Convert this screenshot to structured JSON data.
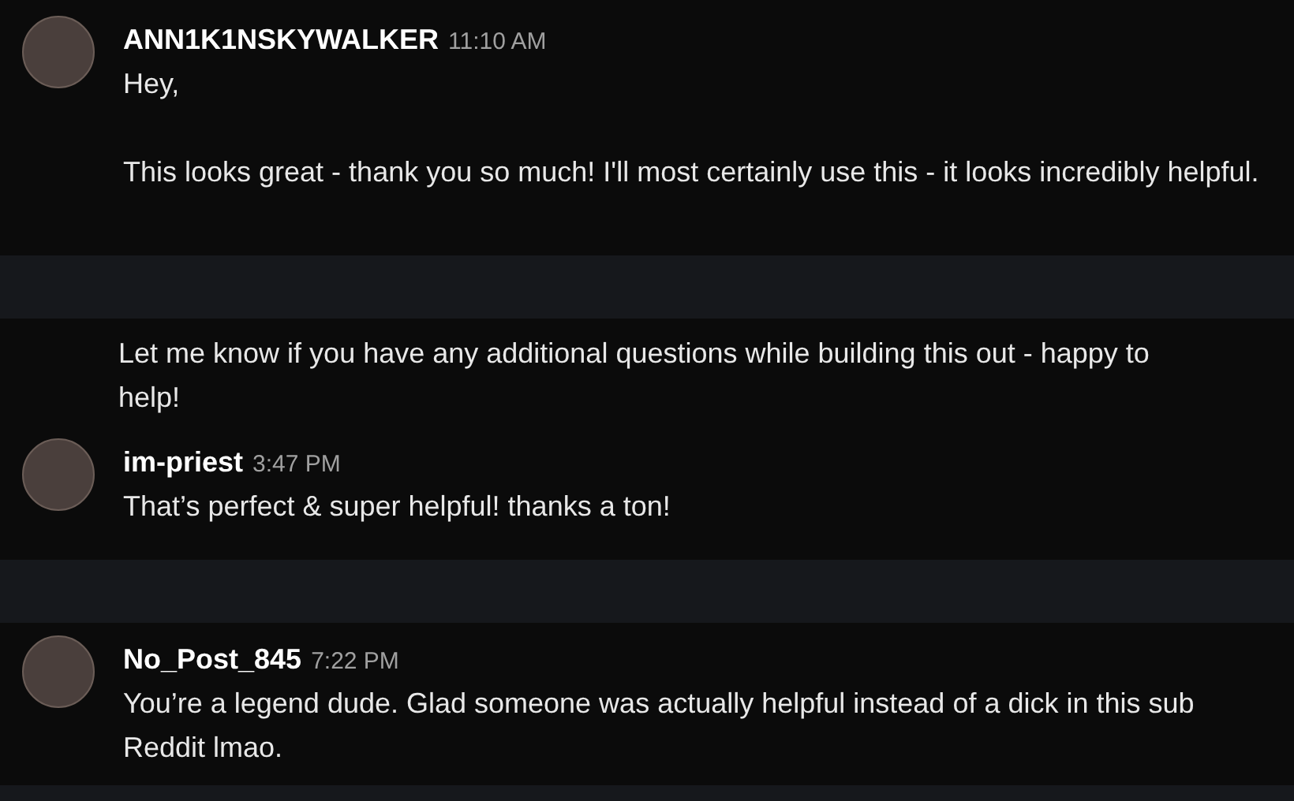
{
  "panels": [
    {
      "messages": [
        {
          "kind": "post",
          "author": "ANN1K1NSKYWALKER",
          "time": "11:10 AM",
          "paragraphs": [
            "Hey,",
            "This looks great - thank you so much! I'll most certainly use this - it looks incredibly helpful."
          ]
        }
      ]
    },
    {
      "messages": [
        {
          "kind": "continuation",
          "paragraphs": [
            "Let me know if you have any additional questions while building this out - happy to help!"
          ]
        },
        {
          "kind": "post",
          "author": "im-priest",
          "time": "3:47 PM",
          "paragraphs": [
            "That’s perfect & super helpful! thanks a ton!"
          ]
        }
      ]
    },
    {
      "messages": [
        {
          "kind": "post",
          "author": "No_Post_845",
          "time": "7:22 PM",
          "paragraphs": [
            "You’re a legend dude. Glad someone was actually helpful instead of a dick in this sub Reddit lmao."
          ]
        }
      ]
    }
  ]
}
